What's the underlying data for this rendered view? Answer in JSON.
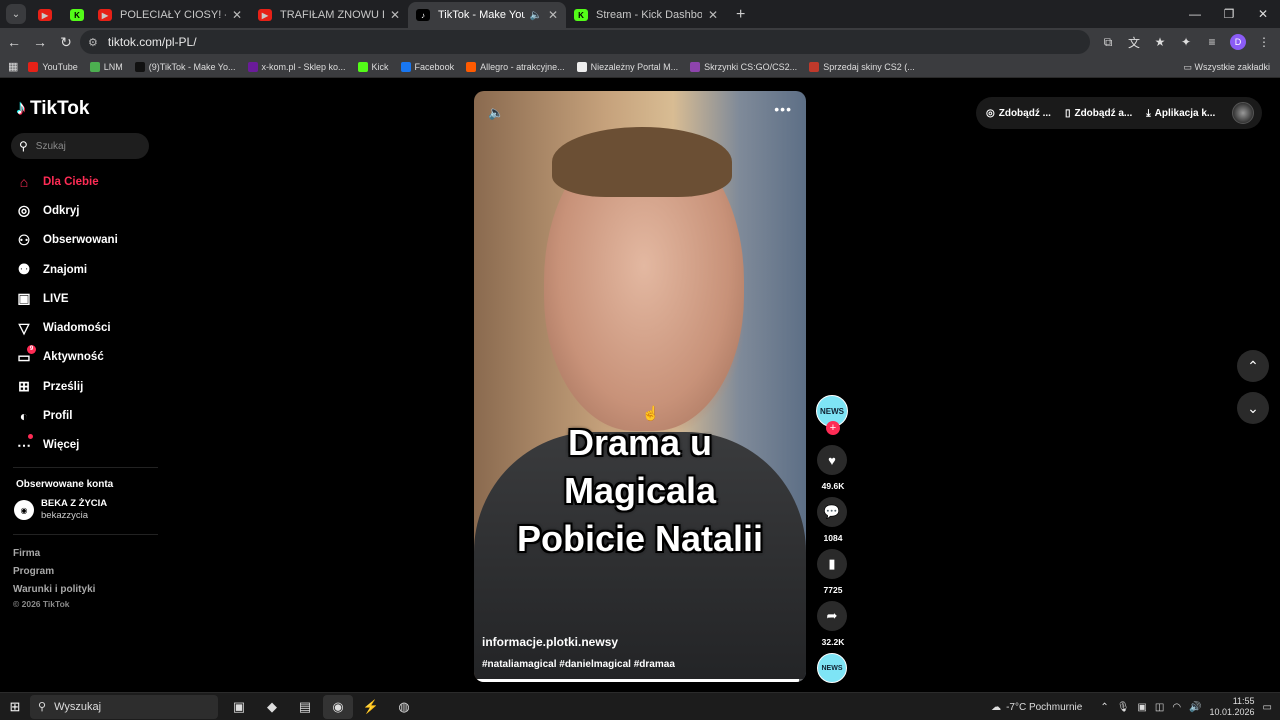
{
  "browser": {
    "tabs": [
      {
        "title": "",
        "favicon": "youtube",
        "active": false
      },
      {
        "title": "",
        "favicon": "kick",
        "active": false
      },
      {
        "title": "POLECIAŁY CIOSY! - WAŻENIE",
        "favicon": "youtube",
        "active": false
      },
      {
        "title": "TRAFIŁAM ZNOWU DO SZPITA",
        "favicon": "youtube",
        "active": false
      },
      {
        "title": "TikTok - Make Your Day",
        "favicon": "tiktok",
        "active": true
      },
      {
        "title": "Stream - Kick Dashboard",
        "favicon": "kick",
        "active": false
      }
    ],
    "url": "tiktok.com/pl-PL/",
    "bookmarks": [
      {
        "label": "YouTube",
        "color": "#e62117"
      },
      {
        "label": "LNM",
        "color": "#4caf50"
      },
      {
        "label": "(9)TikTok - Make Yo...",
        "color": "#111111"
      },
      {
        "label": "x-kom.pl - Sklep ko...",
        "color": "#6a1b9a"
      },
      {
        "label": "Kick",
        "color": "#53fc18"
      },
      {
        "label": "Facebook",
        "color": "#1877f2"
      },
      {
        "label": "Allegro - atrakcyjne...",
        "color": "#ff5a00"
      },
      {
        "label": "Niezależny Portal M...",
        "color": "#eeeeee"
      },
      {
        "label": "Skrzynki CS:GO/CS2...",
        "color": "#8e44ad"
      },
      {
        "label": "Sprzedaj skiny CS2 (...",
        "color": "#c0392b"
      }
    ],
    "all_bookmarks": "Wszystkie zakładki"
  },
  "sidebar": {
    "logo": "TikTok",
    "search_placeholder": "Szukaj",
    "items": [
      {
        "label": "Dla Ciebie",
        "icon": "home-icon",
        "active": true
      },
      {
        "label": "Odkryj",
        "icon": "compass-icon"
      },
      {
        "label": "Obserwowani",
        "icon": "user-follow-icon"
      },
      {
        "label": "Znajomi",
        "icon": "friends-icon"
      },
      {
        "label": "LIVE",
        "icon": "live-icon"
      },
      {
        "label": "Wiadomości",
        "icon": "send-icon"
      },
      {
        "label": "Aktywność",
        "icon": "activity-icon",
        "badge": "9"
      },
      {
        "label": "Prześlij",
        "icon": "upload-icon"
      },
      {
        "label": "Profil",
        "icon": "profile-icon"
      },
      {
        "label": "Więcej",
        "icon": "more-icon"
      }
    ],
    "followed_title": "Obserwowane konta",
    "followed": [
      {
        "name": "BEKA Z ŻYCIA",
        "handle": "bekazzycia"
      }
    ],
    "footer_links": [
      "Firma",
      "Program",
      "Warunki i polityki"
    ],
    "copyright": "© 2026 TikTok"
  },
  "video": {
    "overlay_lines": [
      "Drama u",
      "Magicala",
      "Pobicie Natalii"
    ],
    "author": "informacje.plotki.newsy",
    "hashtags": "#nataliamagical #danielmagical #dramaa",
    "progress": 0.98,
    "avatar_label": "NEWS"
  },
  "actions": {
    "likes": "49.6K",
    "comments": "1084",
    "saves": "7725",
    "shares": "32.2K"
  },
  "topbar": {
    "items": [
      "Zdobądź ...",
      "Zdobądź a...",
      "Aplikacja k..."
    ]
  },
  "taskbar": {
    "search_label": "Wyszukaj",
    "weather": "-7°C  Pochmurnie",
    "time": "11:55",
    "date": "10.01.2026"
  },
  "colors": {
    "accent": "#fe2c55",
    "background": "#000000"
  }
}
